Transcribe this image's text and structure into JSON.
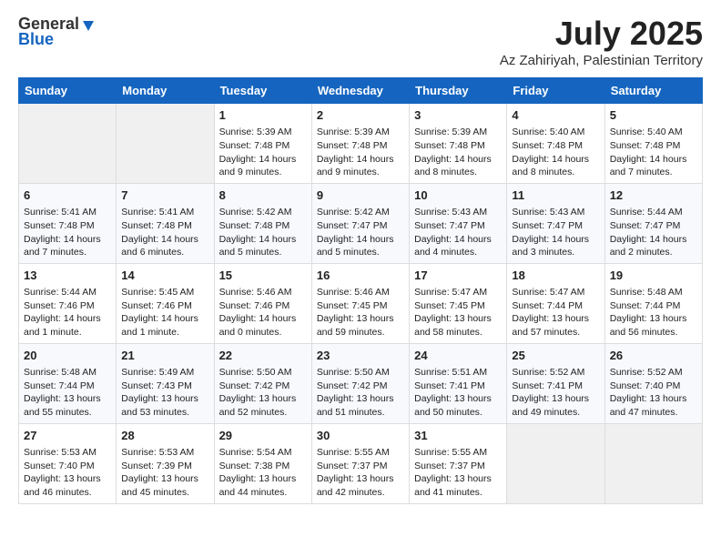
{
  "logo": {
    "general": "General",
    "blue": "Blue"
  },
  "title": "July 2025",
  "location": "Az Zahiriyah, Palestinian Territory",
  "weekdays": [
    "Sunday",
    "Monday",
    "Tuesday",
    "Wednesday",
    "Thursday",
    "Friday",
    "Saturday"
  ],
  "weeks": [
    [
      {
        "day": "",
        "info": ""
      },
      {
        "day": "",
        "info": ""
      },
      {
        "day": "1",
        "info": "Sunrise: 5:39 AM\nSunset: 7:48 PM\nDaylight: 14 hours and 9 minutes."
      },
      {
        "day": "2",
        "info": "Sunrise: 5:39 AM\nSunset: 7:48 PM\nDaylight: 14 hours and 9 minutes."
      },
      {
        "day": "3",
        "info": "Sunrise: 5:39 AM\nSunset: 7:48 PM\nDaylight: 14 hours and 8 minutes."
      },
      {
        "day": "4",
        "info": "Sunrise: 5:40 AM\nSunset: 7:48 PM\nDaylight: 14 hours and 8 minutes."
      },
      {
        "day": "5",
        "info": "Sunrise: 5:40 AM\nSunset: 7:48 PM\nDaylight: 14 hours and 7 minutes."
      }
    ],
    [
      {
        "day": "6",
        "info": "Sunrise: 5:41 AM\nSunset: 7:48 PM\nDaylight: 14 hours and 7 minutes."
      },
      {
        "day": "7",
        "info": "Sunrise: 5:41 AM\nSunset: 7:48 PM\nDaylight: 14 hours and 6 minutes."
      },
      {
        "day": "8",
        "info": "Sunrise: 5:42 AM\nSunset: 7:48 PM\nDaylight: 14 hours and 5 minutes."
      },
      {
        "day": "9",
        "info": "Sunrise: 5:42 AM\nSunset: 7:47 PM\nDaylight: 14 hours and 5 minutes."
      },
      {
        "day": "10",
        "info": "Sunrise: 5:43 AM\nSunset: 7:47 PM\nDaylight: 14 hours and 4 minutes."
      },
      {
        "day": "11",
        "info": "Sunrise: 5:43 AM\nSunset: 7:47 PM\nDaylight: 14 hours and 3 minutes."
      },
      {
        "day": "12",
        "info": "Sunrise: 5:44 AM\nSunset: 7:47 PM\nDaylight: 14 hours and 2 minutes."
      }
    ],
    [
      {
        "day": "13",
        "info": "Sunrise: 5:44 AM\nSunset: 7:46 PM\nDaylight: 14 hours and 1 minute."
      },
      {
        "day": "14",
        "info": "Sunrise: 5:45 AM\nSunset: 7:46 PM\nDaylight: 14 hours and 1 minute."
      },
      {
        "day": "15",
        "info": "Sunrise: 5:46 AM\nSunset: 7:46 PM\nDaylight: 14 hours and 0 minutes."
      },
      {
        "day": "16",
        "info": "Sunrise: 5:46 AM\nSunset: 7:45 PM\nDaylight: 13 hours and 59 minutes."
      },
      {
        "day": "17",
        "info": "Sunrise: 5:47 AM\nSunset: 7:45 PM\nDaylight: 13 hours and 58 minutes."
      },
      {
        "day": "18",
        "info": "Sunrise: 5:47 AM\nSunset: 7:44 PM\nDaylight: 13 hours and 57 minutes."
      },
      {
        "day": "19",
        "info": "Sunrise: 5:48 AM\nSunset: 7:44 PM\nDaylight: 13 hours and 56 minutes."
      }
    ],
    [
      {
        "day": "20",
        "info": "Sunrise: 5:48 AM\nSunset: 7:44 PM\nDaylight: 13 hours and 55 minutes."
      },
      {
        "day": "21",
        "info": "Sunrise: 5:49 AM\nSunset: 7:43 PM\nDaylight: 13 hours and 53 minutes."
      },
      {
        "day": "22",
        "info": "Sunrise: 5:50 AM\nSunset: 7:42 PM\nDaylight: 13 hours and 52 minutes."
      },
      {
        "day": "23",
        "info": "Sunrise: 5:50 AM\nSunset: 7:42 PM\nDaylight: 13 hours and 51 minutes."
      },
      {
        "day": "24",
        "info": "Sunrise: 5:51 AM\nSunset: 7:41 PM\nDaylight: 13 hours and 50 minutes."
      },
      {
        "day": "25",
        "info": "Sunrise: 5:52 AM\nSunset: 7:41 PM\nDaylight: 13 hours and 49 minutes."
      },
      {
        "day": "26",
        "info": "Sunrise: 5:52 AM\nSunset: 7:40 PM\nDaylight: 13 hours and 47 minutes."
      }
    ],
    [
      {
        "day": "27",
        "info": "Sunrise: 5:53 AM\nSunset: 7:40 PM\nDaylight: 13 hours and 46 minutes."
      },
      {
        "day": "28",
        "info": "Sunrise: 5:53 AM\nSunset: 7:39 PM\nDaylight: 13 hours and 45 minutes."
      },
      {
        "day": "29",
        "info": "Sunrise: 5:54 AM\nSunset: 7:38 PM\nDaylight: 13 hours and 44 minutes."
      },
      {
        "day": "30",
        "info": "Sunrise: 5:55 AM\nSunset: 7:37 PM\nDaylight: 13 hours and 42 minutes."
      },
      {
        "day": "31",
        "info": "Sunrise: 5:55 AM\nSunset: 7:37 PM\nDaylight: 13 hours and 41 minutes."
      },
      {
        "day": "",
        "info": ""
      },
      {
        "day": "",
        "info": ""
      }
    ]
  ]
}
